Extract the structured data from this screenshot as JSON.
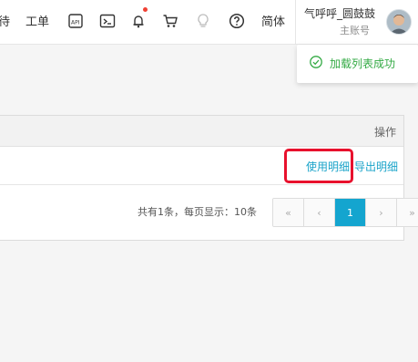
{
  "topbar": {
    "left_fragment": "待",
    "tickets_label": "工单",
    "language_label": "简体",
    "icons": [
      "api-icon",
      "terminal-icon",
      "bell-icon",
      "cart-icon",
      "bulb-icon",
      "help-icon"
    ]
  },
  "user": {
    "name": "气呼呼_圆鼓鼓",
    "role": "主账号"
  },
  "toast": {
    "message": "加载列表成功",
    "color": "#33aa44"
  },
  "table": {
    "columns": [
      "操作"
    ],
    "rows": [
      {
        "actions": [
          "使用明细",
          "导出明细"
        ]
      }
    ]
  },
  "pagination": {
    "info": "共有1条，每页显示：10条",
    "buttons": [
      "«",
      "‹",
      "1",
      "›",
      "»"
    ],
    "current_page": "1"
  },
  "colors": {
    "link": "#1aa3c9",
    "active_page": "#14a5cf",
    "highlight_box": "#e8112d"
  }
}
